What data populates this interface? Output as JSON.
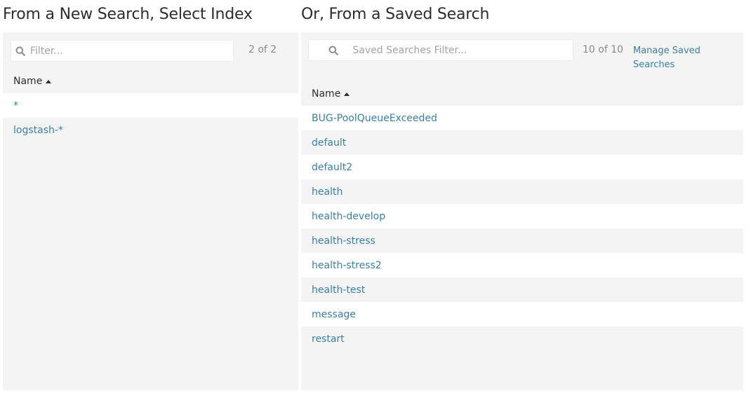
{
  "left": {
    "heading": "From a New Search, Select Index",
    "filter_placeholder": "Filter...",
    "count": "2 of 2",
    "column_header": "Name",
    "sort_icon": "caret-up-icon",
    "items": [
      "*",
      "logstash-*"
    ]
  },
  "right": {
    "heading": "Or, From a Saved Search",
    "filter_placeholder": "Saved Searches Filter...",
    "count": "10 of 10",
    "manage_link": "Manage Saved Searches",
    "column_header": "Name",
    "sort_icon": "caret-up-icon",
    "items": [
      "BUG-PoolQueueExceeded",
      "default",
      "default2",
      "health",
      "health-develop",
      "health-stress",
      "health-stress2",
      "health-test",
      "message",
      "restart"
    ]
  },
  "icons": {
    "search": "search-icon"
  },
  "colors": {
    "link": "#3a7fa0",
    "panel_bg": "#f4f4f4",
    "row_alt": "#ffffff",
    "muted_text": "#8a8a8a",
    "placeholder": "#a3a3a3"
  }
}
